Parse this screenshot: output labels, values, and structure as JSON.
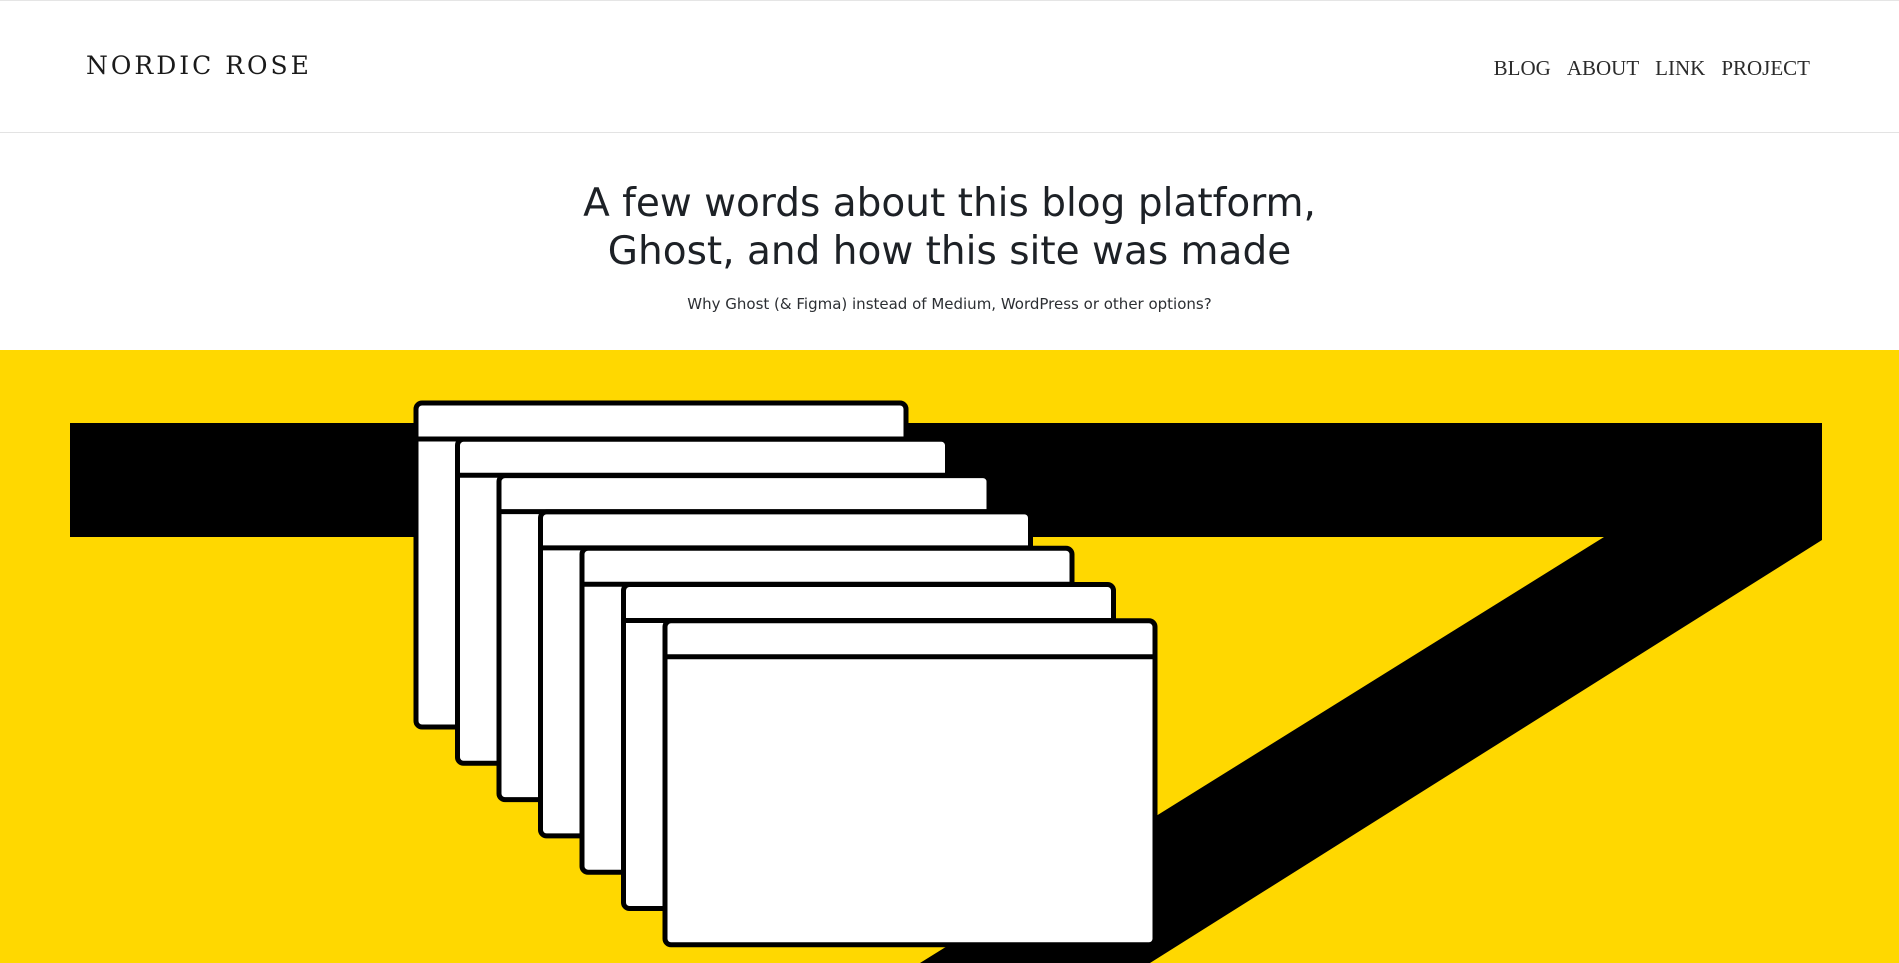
{
  "site": {
    "logo": "NORDIC ROSE"
  },
  "nav": {
    "items": [
      "BLOG",
      "ABOUT",
      "LINK",
      "PROJECT"
    ]
  },
  "article": {
    "title_lines": [
      "A few words about this blog platform,",
      "Ghost, and how this site was made"
    ],
    "subtitle": "Why Ghost (& Figma) instead of Medium, WordPress or other options?"
  },
  "hero_image": {
    "background_color": "#FFD800",
    "accent_color": "#000000",
    "window_color": "#FFFFFF",
    "window_count": 7
  }
}
